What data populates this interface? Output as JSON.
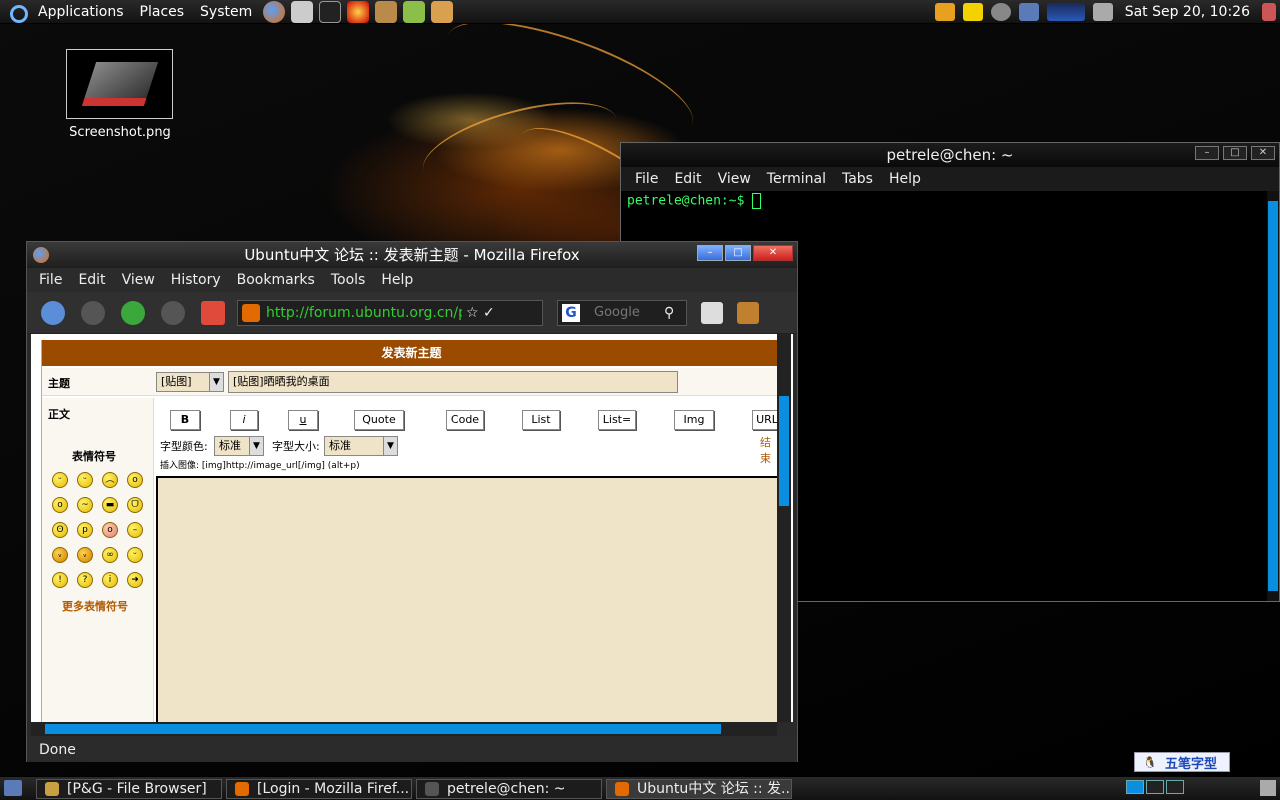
{
  "top_panel": {
    "menus": [
      "Applications",
      "Places",
      "System"
    ],
    "clock": "Sat Sep 20, 10:26"
  },
  "desktop": {
    "icon_label": "Screenshot.png"
  },
  "terminal": {
    "title": "petrele@chen: ~",
    "menus": [
      "File",
      "Edit",
      "View",
      "Terminal",
      "Tabs",
      "Help"
    ],
    "prompt": "petrele@chen:~$"
  },
  "firefox": {
    "title": "Ubuntu中文 论坛 :: 发表新主题 - Mozilla Firefox",
    "menus": [
      "File",
      "Edit",
      "View",
      "History",
      "Bookmarks",
      "Tools",
      "Help"
    ],
    "url": "http://forum.ubuntu.org.cn/p",
    "search_placeholder": "Google",
    "status": "Done"
  },
  "page": {
    "header": "发表新主题",
    "subject_label": "主题",
    "subject_select": "[贴图]",
    "subject_value": "[贴图]晒晒我的桌面",
    "body_label": "正文",
    "buttons": [
      "B",
      "i",
      "u",
      "Quote",
      "Code",
      "List",
      "List=",
      "Img",
      "URL"
    ],
    "font_color_label": "字型颜色:",
    "font_color_value": "标准",
    "font_size_label": "字型大小:",
    "font_size_value": "标准",
    "end_link": "结束",
    "insert_hint": "插入图像: [img]http://image_url[/img]  (alt+p)",
    "smilies_title": "表情符号",
    "more_smilies": "更多表情符号"
  },
  "ime": {
    "label": "五笔字型"
  },
  "taskbar": {
    "tasks": [
      "[P&G - File Browser]",
      "[Login - Mozilla Firef...",
      "petrele@chen: ~",
      "Ubuntu中文 论坛 :: 发..."
    ]
  },
  "colors": {
    "accent_blue": "#0a8ee0",
    "page_header": "#9a4b00",
    "terminal_text": "#33ff66"
  }
}
